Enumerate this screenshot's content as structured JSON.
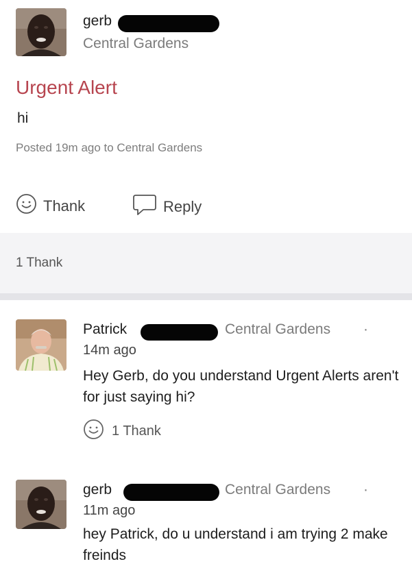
{
  "post": {
    "author": "gerb",
    "neighborhood": "Central Gardens",
    "title": "Urgent Alert",
    "body": "hi",
    "posted": "Posted 19m ago to Central Gardens",
    "actions": {
      "thank_label": "Thank",
      "reply_label": "Reply"
    },
    "thanks_summary": "1 Thank"
  },
  "comments": [
    {
      "author": "Patrick",
      "neighborhood": "Central Gardens",
      "separator": "·",
      "time": "14m ago",
      "text": "Hey Gerb, do you understand Urgent Alerts aren't for just saying hi?",
      "thanks": "1 Thank"
    },
    {
      "author": "gerb",
      "neighborhood": "Central Gardens",
      "separator": "·",
      "time": "11m ago",
      "text": "hey Patrick, do u understand i am trying 2 make freinds"
    }
  ],
  "icons": {
    "thank": "smiley-icon",
    "reply": "speech-bubble-icon"
  },
  "colors": {
    "alert_title": "#b7454f",
    "redaction": "#050505",
    "meta_gray": "#7b7b7b",
    "summary_background": "#f4f4f6"
  }
}
